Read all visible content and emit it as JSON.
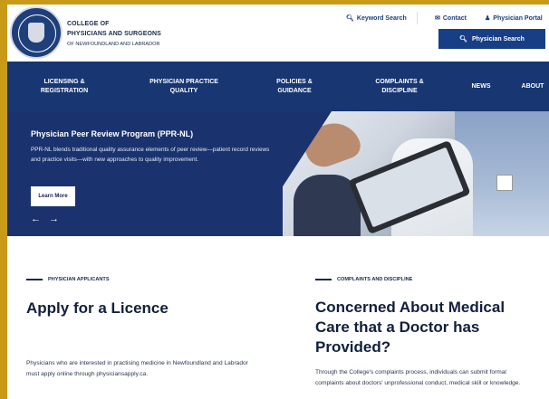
{
  "header": {
    "org_line1": "COLLEGE OF",
    "org_line2": "PHYSICIANS AND SURGEONS",
    "org_line3": "OF NEWFOUNDLAND AND LABRADOR",
    "keyword_search": "Keyword Search",
    "contact": "Contact",
    "physician_portal": "Physician Portal",
    "physician_search": "Physician Search",
    "icons": {
      "search": "search-icon",
      "contact": "envelope-icon",
      "portal": "users-icon"
    }
  },
  "nav": {
    "items": [
      {
        "line1": "LICENSING &",
        "line2": "REGISTRATION"
      },
      {
        "line1": "PHYSICIAN PRACTICE",
        "line2": "QUALITY"
      },
      {
        "line1": "POLICIES &",
        "line2": "GUIDANCE"
      },
      {
        "line1": "COMPLAINTS &",
        "line2": "DISCIPLINE"
      },
      {
        "line1": "NEWS",
        "line2": ""
      },
      {
        "line1": "ABOUT",
        "line2": ""
      }
    ]
  },
  "hero": {
    "title": "Physician Peer Review Program (PPR-NL)",
    "text": "PPR-NL blends traditional quality assurance elements of peer review—patient record reviews and practice visits—with new approaches to quality improvement.",
    "button": "Learn More",
    "prev_arrow": "←",
    "next_arrow": "→"
  },
  "left_col": {
    "eyebrow": "PHYSICIAN APPLICANTS",
    "heading": "Apply for a Licence",
    "body": "Physicians who are interested in practising medicine in Newfoundland and Labrador must apply online through physiciansapply.ca."
  },
  "right_col": {
    "eyebrow": "COMPLAINTS AND DISCIPLINE",
    "heading_line1": "Concerned About Medical",
    "heading_line2": "Care that a Doctor has",
    "heading_line3": "Provided?",
    "body": "Through the College's complaints process, individuals can submit formal complaints about doctors' unprofessional conduct, medical skill or knowledge."
  },
  "colors": {
    "frame": "#c99a18",
    "navy": "#173672",
    "button_blue": "#183e85"
  }
}
